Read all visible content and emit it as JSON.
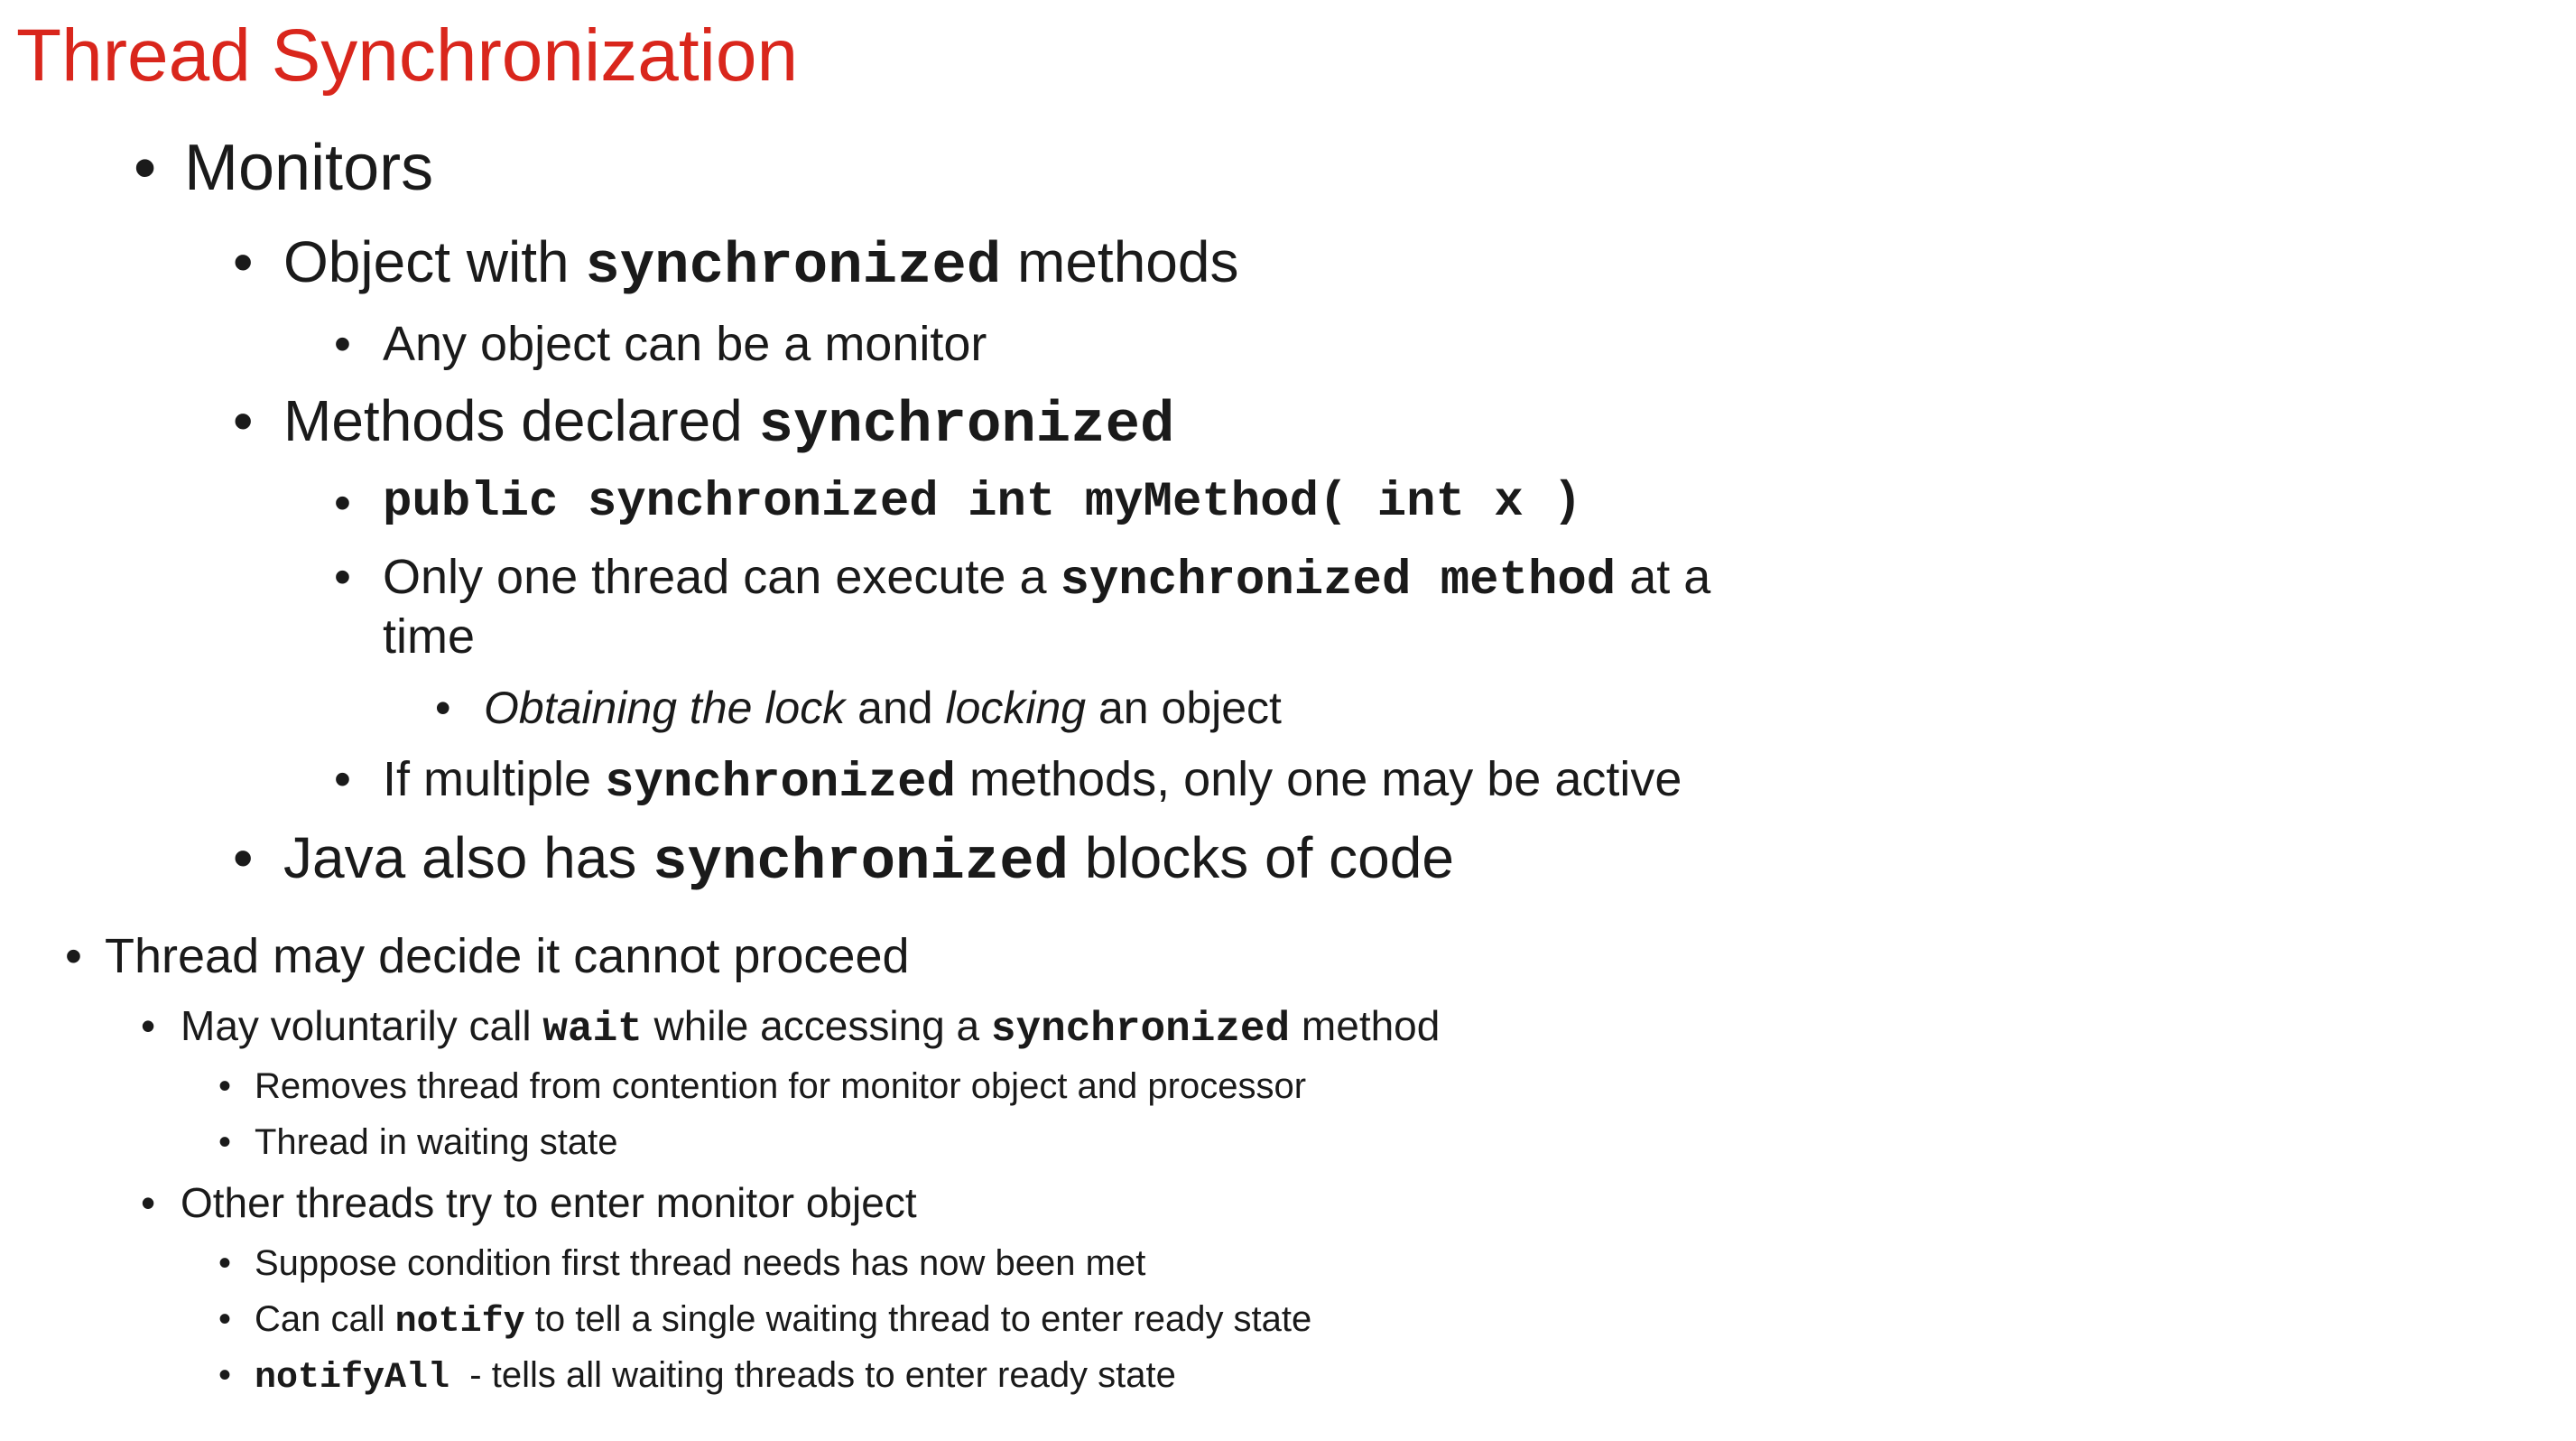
{
  "slide": {
    "title": "Thread Synchronization",
    "bullet_char": "•",
    "monitors": {
      "heading": "Monitors",
      "object_with": {
        "pre": "Object with ",
        "code": "synchronized",
        "post": " methods"
      },
      "any_object": "Any object can be a monitor",
      "methods_declared": {
        "pre": "Methods declared ",
        "code": "synchronized"
      },
      "signature_code": "public synchronized int myMethod( int x )",
      "only_one": {
        "pre": "Only one thread can execute a ",
        "code": "synchronized method",
        "post": " at a",
        "wrap": "time"
      },
      "obtaining": {
        "italic1": "Obtaining the lock",
        "mid": " and ",
        "italic2": "locking",
        "post": " an object"
      },
      "if_multiple": {
        "pre": "If multiple ",
        "code": "synchronized",
        "post": " methods, only one may be active"
      },
      "java_blocks": {
        "pre": "Java also has ",
        "code": "synchronized",
        "post": " blocks of code"
      }
    },
    "cannot_proceed": {
      "heading": "Thread may decide it cannot proceed",
      "may_wait": {
        "pre": "May voluntarily call ",
        "code1": "wait",
        "mid": " while accessing a ",
        "code2": "synchronized",
        "post": " method"
      },
      "removes": "Removes thread from contention for monitor object and processor",
      "waiting_state": "Thread in waiting state",
      "other_threads": "Other threads try to enter monitor object",
      "suppose": "Suppose condition first thread needs has now been met",
      "can_call": {
        "pre": "Can call ",
        "code": "notify",
        "post": " to tell a single waiting thread to enter ready state"
      },
      "notify_all": {
        "code": "notifyAll",
        "post": "  - tells all waiting threads to enter ready state"
      }
    },
    "colors": {
      "title": "#d9261c",
      "text": "#1a1a1a",
      "background": "#ffffff"
    }
  }
}
